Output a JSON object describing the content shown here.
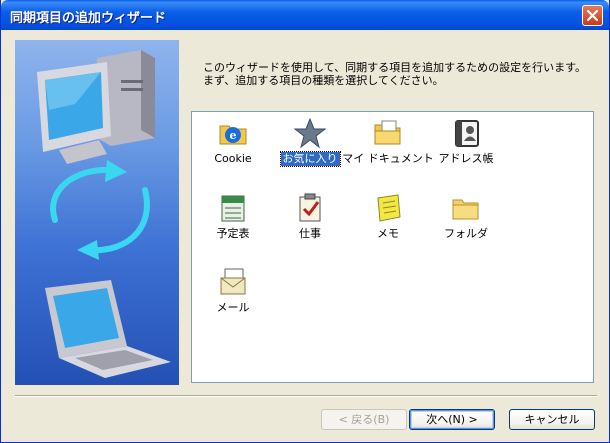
{
  "window": {
    "title": "同期項目の追加ウィザード"
  },
  "intro": {
    "line1": "このウィザードを使用して、同期する項目を追加するための設定を行います。",
    "line2": "まず、追加する項目の種類を選択してください。"
  },
  "items": [
    {
      "label": "Cookie",
      "icon": "cookie-folder-icon",
      "selected": false
    },
    {
      "label": "お気に入り",
      "icon": "favorites-star-icon",
      "selected": true
    },
    {
      "label": "マイ ドキュメント",
      "icon": "my-documents-icon",
      "selected": false
    },
    {
      "label": "アドレス帳",
      "icon": "address-book-icon",
      "selected": false
    },
    {
      "label": "予定表",
      "icon": "calendar-icon",
      "selected": false
    },
    {
      "label": "仕事",
      "icon": "tasks-icon",
      "selected": false
    },
    {
      "label": "メモ",
      "icon": "notes-icon",
      "selected": false
    },
    {
      "label": "フォルダ",
      "icon": "folder-icon",
      "selected": false
    },
    {
      "label": "メール",
      "icon": "mail-icon",
      "selected": false
    }
  ],
  "buttons": {
    "back": "< 戻る(B)",
    "next": "次へ(N) >",
    "cancel": "キャンセル"
  },
  "colors": {
    "titlebar": "#0a5ce6",
    "selection": "#316ac5",
    "dialog_bg": "#ece9d8"
  }
}
